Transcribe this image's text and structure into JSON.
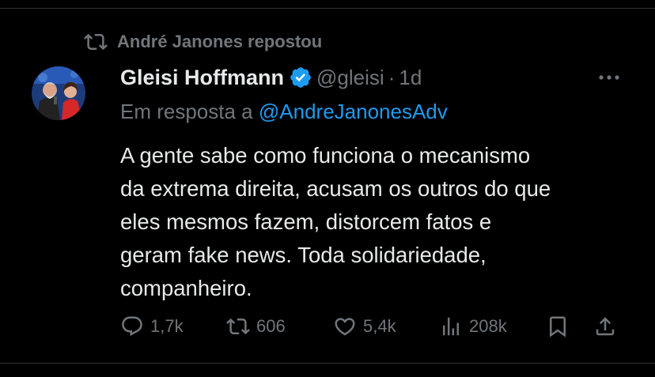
{
  "repost": {
    "text": "André Janones repostou",
    "icon": "repost-icon"
  },
  "author": {
    "name": "Gleisi Hoffmann",
    "handle": "@gleisi",
    "separator": "·",
    "time": "1d",
    "verified": true,
    "avatar": "avatar-photo"
  },
  "reply": {
    "prefix": "Em resposta a",
    "to": "@AndreJanonesAdv"
  },
  "tweet": {
    "lines": [
      "A gente sabe como funciona o mecanismo",
      "da extrema direita, acusam os outros do que",
      "eles mesmos fazem, distorcem fatos e",
      "geram fake news. Toda solidariedade,",
      "companheiro."
    ]
  },
  "actions": {
    "replies": "1,7k",
    "reposts": "606",
    "likes": "5,4k",
    "views": "208k"
  },
  "colors": {
    "background": "#000000",
    "text": "#e7e9ea",
    "muted": "#71767b",
    "accent": "#1d9bf0"
  }
}
